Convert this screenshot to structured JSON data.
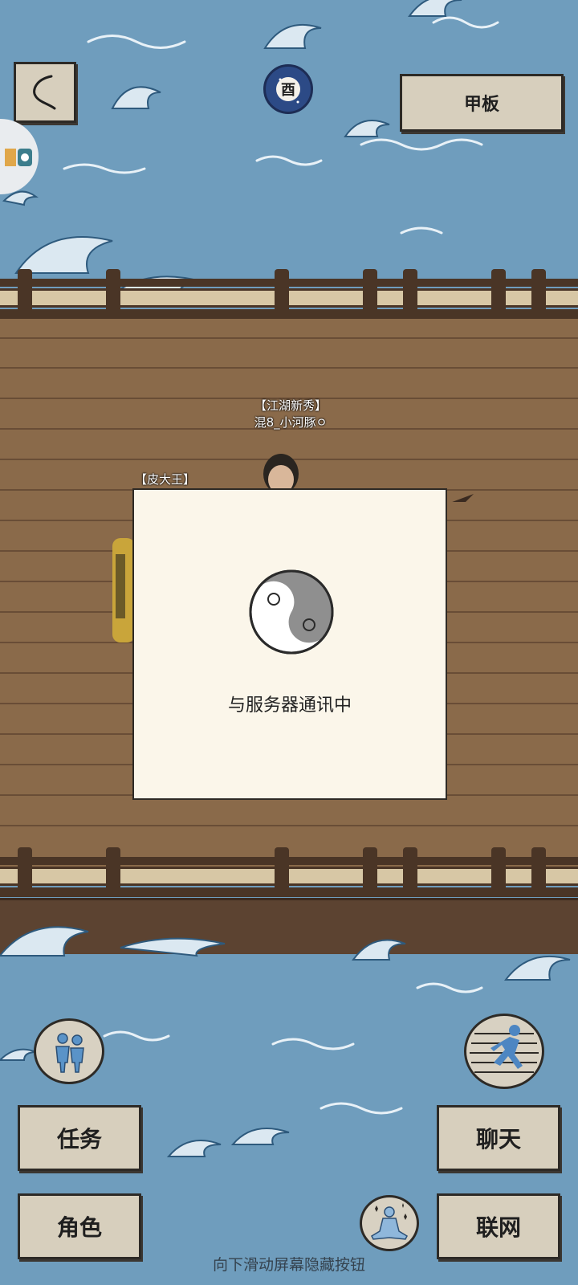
{
  "header": {
    "back_icon": "chevron-left-icon",
    "time_badge": "酉",
    "location_button": "甲板",
    "side_widget_icon": "app-shortcut-icon"
  },
  "players": [
    {
      "title": "【江湖新秀】",
      "name": "混8_小河豚ㅇ"
    },
    {
      "title": "【皮大王】",
      "name": ""
    }
  ],
  "modal": {
    "icon": "yin-yang-icon",
    "message": "与服务器通讯中"
  },
  "bottom": {
    "left_round_icon": "companions-icon",
    "right_round_icon": "running-icon",
    "meditate_icon": "meditation-icon",
    "task_button": "任务",
    "role_button": "角色",
    "chat_button": "聊天",
    "network_button": "联网",
    "hint": "向下滑动屏幕隐藏按钮"
  },
  "colors": {
    "sea": "#6f9dbd",
    "deck": "#8a6a4a",
    "paper": "#d7cfbd",
    "modal": "#fbf6ea"
  }
}
